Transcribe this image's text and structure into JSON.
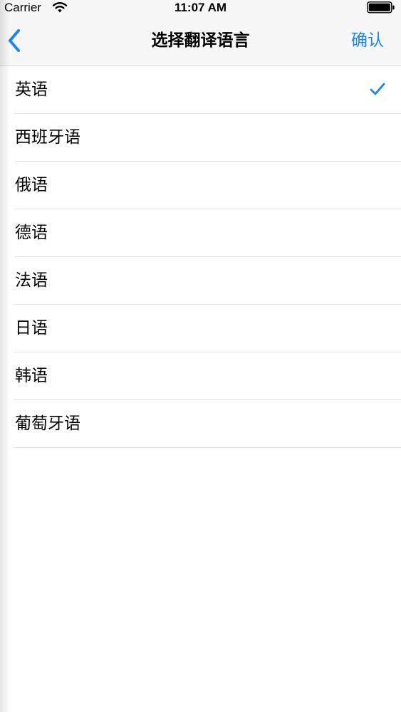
{
  "status_bar": {
    "carrier": "Carrier",
    "time": "11:07 AM",
    "icons": [
      "wifi-icon",
      "battery-icon"
    ]
  },
  "nav": {
    "back_icon": "chevron-left-icon",
    "title": "选择翻译语言",
    "confirm_label": "确认"
  },
  "languages": [
    {
      "label": "英语",
      "selected": true
    },
    {
      "label": "西班牙语",
      "selected": false
    },
    {
      "label": "俄语",
      "selected": false
    },
    {
      "label": "德语",
      "selected": false
    },
    {
      "label": "法语",
      "selected": false
    },
    {
      "label": "日语",
      "selected": false
    },
    {
      "label": "韩语",
      "selected": false
    },
    {
      "label": "葡萄牙语",
      "selected": false
    }
  ],
  "colors": {
    "accent": "#1a86f2",
    "bar_background": "#f7f7f7",
    "separator": "#e2e2e2"
  }
}
